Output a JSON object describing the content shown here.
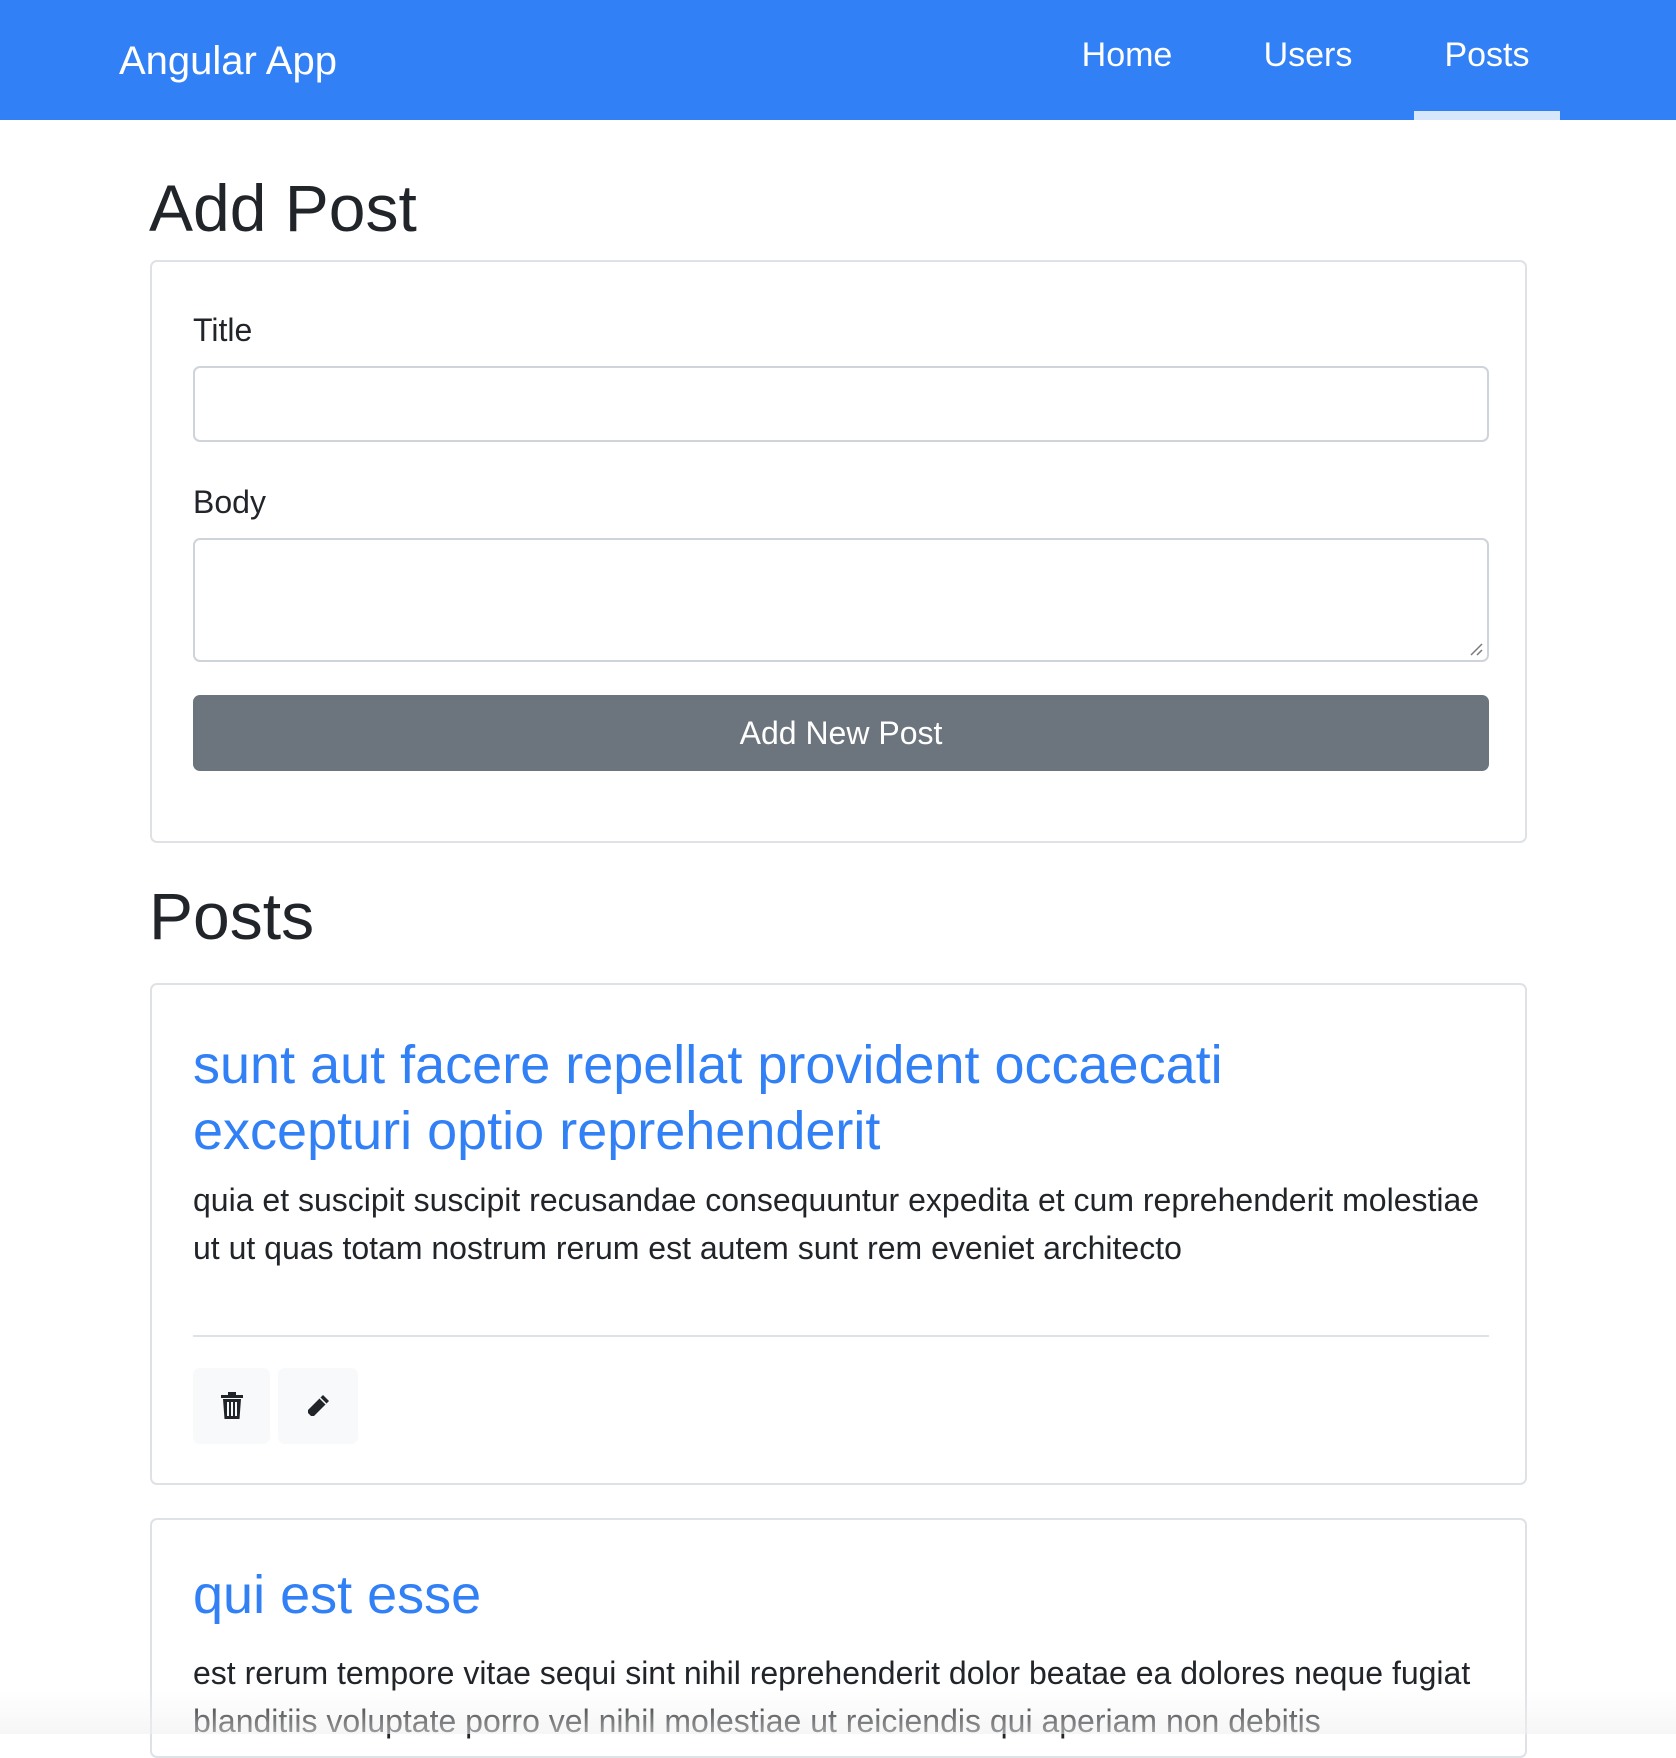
{
  "navbar": {
    "brand": "Angular App",
    "items": [
      {
        "label": "Home",
        "active": false
      },
      {
        "label": "Users",
        "active": false
      },
      {
        "label": "Posts",
        "active": true
      }
    ],
    "color": "#3280f6"
  },
  "add_post": {
    "heading": "Add Post",
    "title_label": "Title",
    "title_value": "",
    "body_label": "Body",
    "body_value": "",
    "submit_label": "Add New Post"
  },
  "posts": {
    "heading": "Posts",
    "items": [
      {
        "title": "sunt aut facere repellat provident occaecati excepturi optio reprehenderit",
        "body": "quia et suscipit suscipit recusandae consequuntur expedita et cum reprehenderit molestiae ut ut quas totam nostrum rerum est autem sunt rem eveniet architecto",
        "actions": [
          "trash-icon",
          "pencil-icon"
        ]
      },
      {
        "title": "qui est esse",
        "body": "est rerum tempore vitae sequi sint nihil reprehenderit dolor beatae ea dolores neque fugiat blanditiis voluptate porro vel nihil molestiae ut reiciendis qui aperiam non debitis"
      }
    ]
  }
}
